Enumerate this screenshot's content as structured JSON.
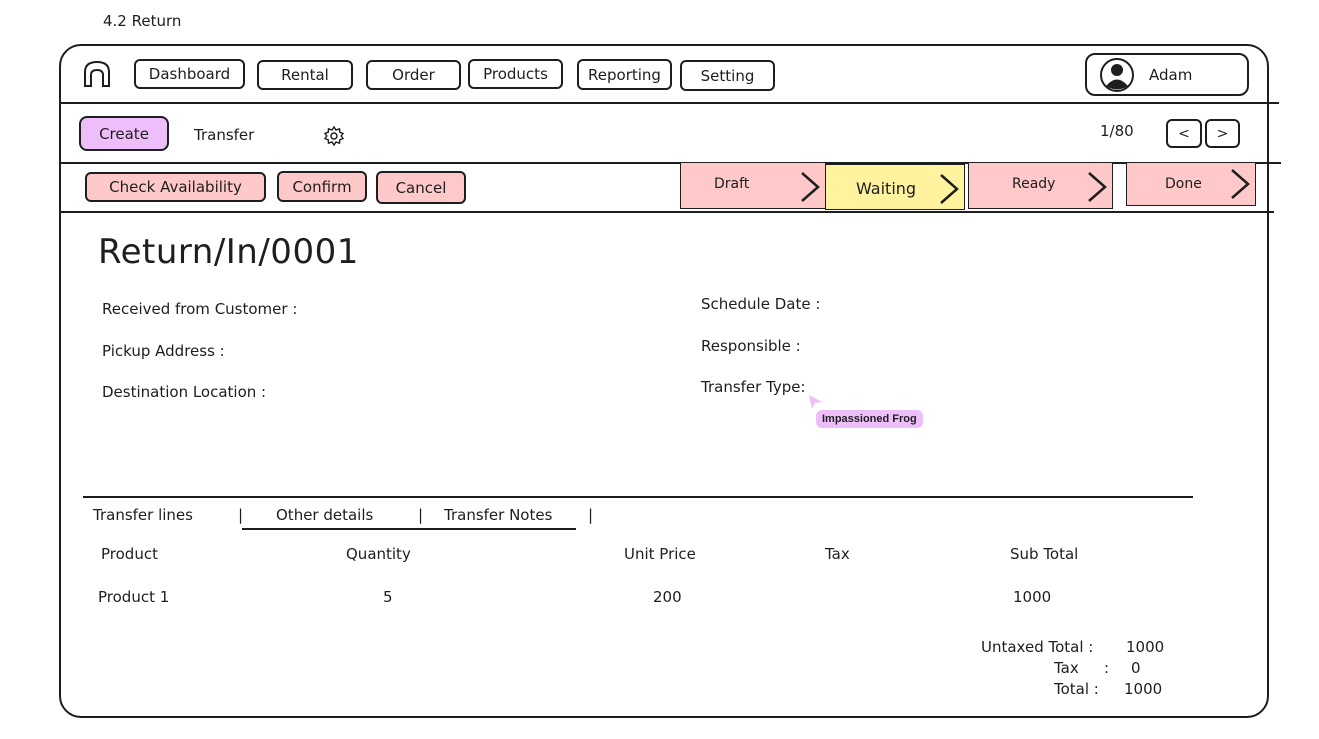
{
  "sheet": {
    "label": "4.2 Return"
  },
  "nav": {
    "items": [
      "Dashboard",
      "Rental",
      "Order",
      "Products",
      "Reporting",
      "Setting"
    ],
    "user": "Adam"
  },
  "toolbar": {
    "create": "Create",
    "section": "Transfer",
    "pager": "1/80",
    "prev": "<",
    "next": ">"
  },
  "actions": {
    "check": "Check Availability",
    "confirm": "Confirm",
    "cancel": "Cancel"
  },
  "stages": {
    "items": [
      "Draft",
      "Waiting",
      "Ready",
      "Done"
    ],
    "active": "Waiting",
    "colors": {
      "default": "#ffc9c9",
      "active": "#fff3a0"
    }
  },
  "record": {
    "title": "Return/In/0001",
    "left_fields": [
      "Received from Customer :",
      "Pickup Address :",
      "Destination Location :"
    ],
    "right_fields": [
      "Schedule Date :",
      "Responsible :",
      "Transfer Type:"
    ]
  },
  "collab": {
    "cursor_name": "Impassioned Frog"
  },
  "tabs": {
    "items": [
      "Transfer lines",
      "Other details",
      "Transfer Notes"
    ],
    "separator": "|"
  },
  "lines": {
    "headers": [
      "Product",
      "Quantity",
      "Unit Price",
      "Tax",
      "Sub Total"
    ],
    "rows": [
      [
        "Product 1",
        "5",
        "200",
        "",
        "1000"
      ]
    ]
  },
  "totals": {
    "untaxed_label": "Untaxed Total :",
    "untaxed_value": "1000",
    "tax_label": "Tax",
    "tax_sep": ":",
    "tax_value": "0",
    "total_label": "Total :",
    "total_value": "1000"
  }
}
